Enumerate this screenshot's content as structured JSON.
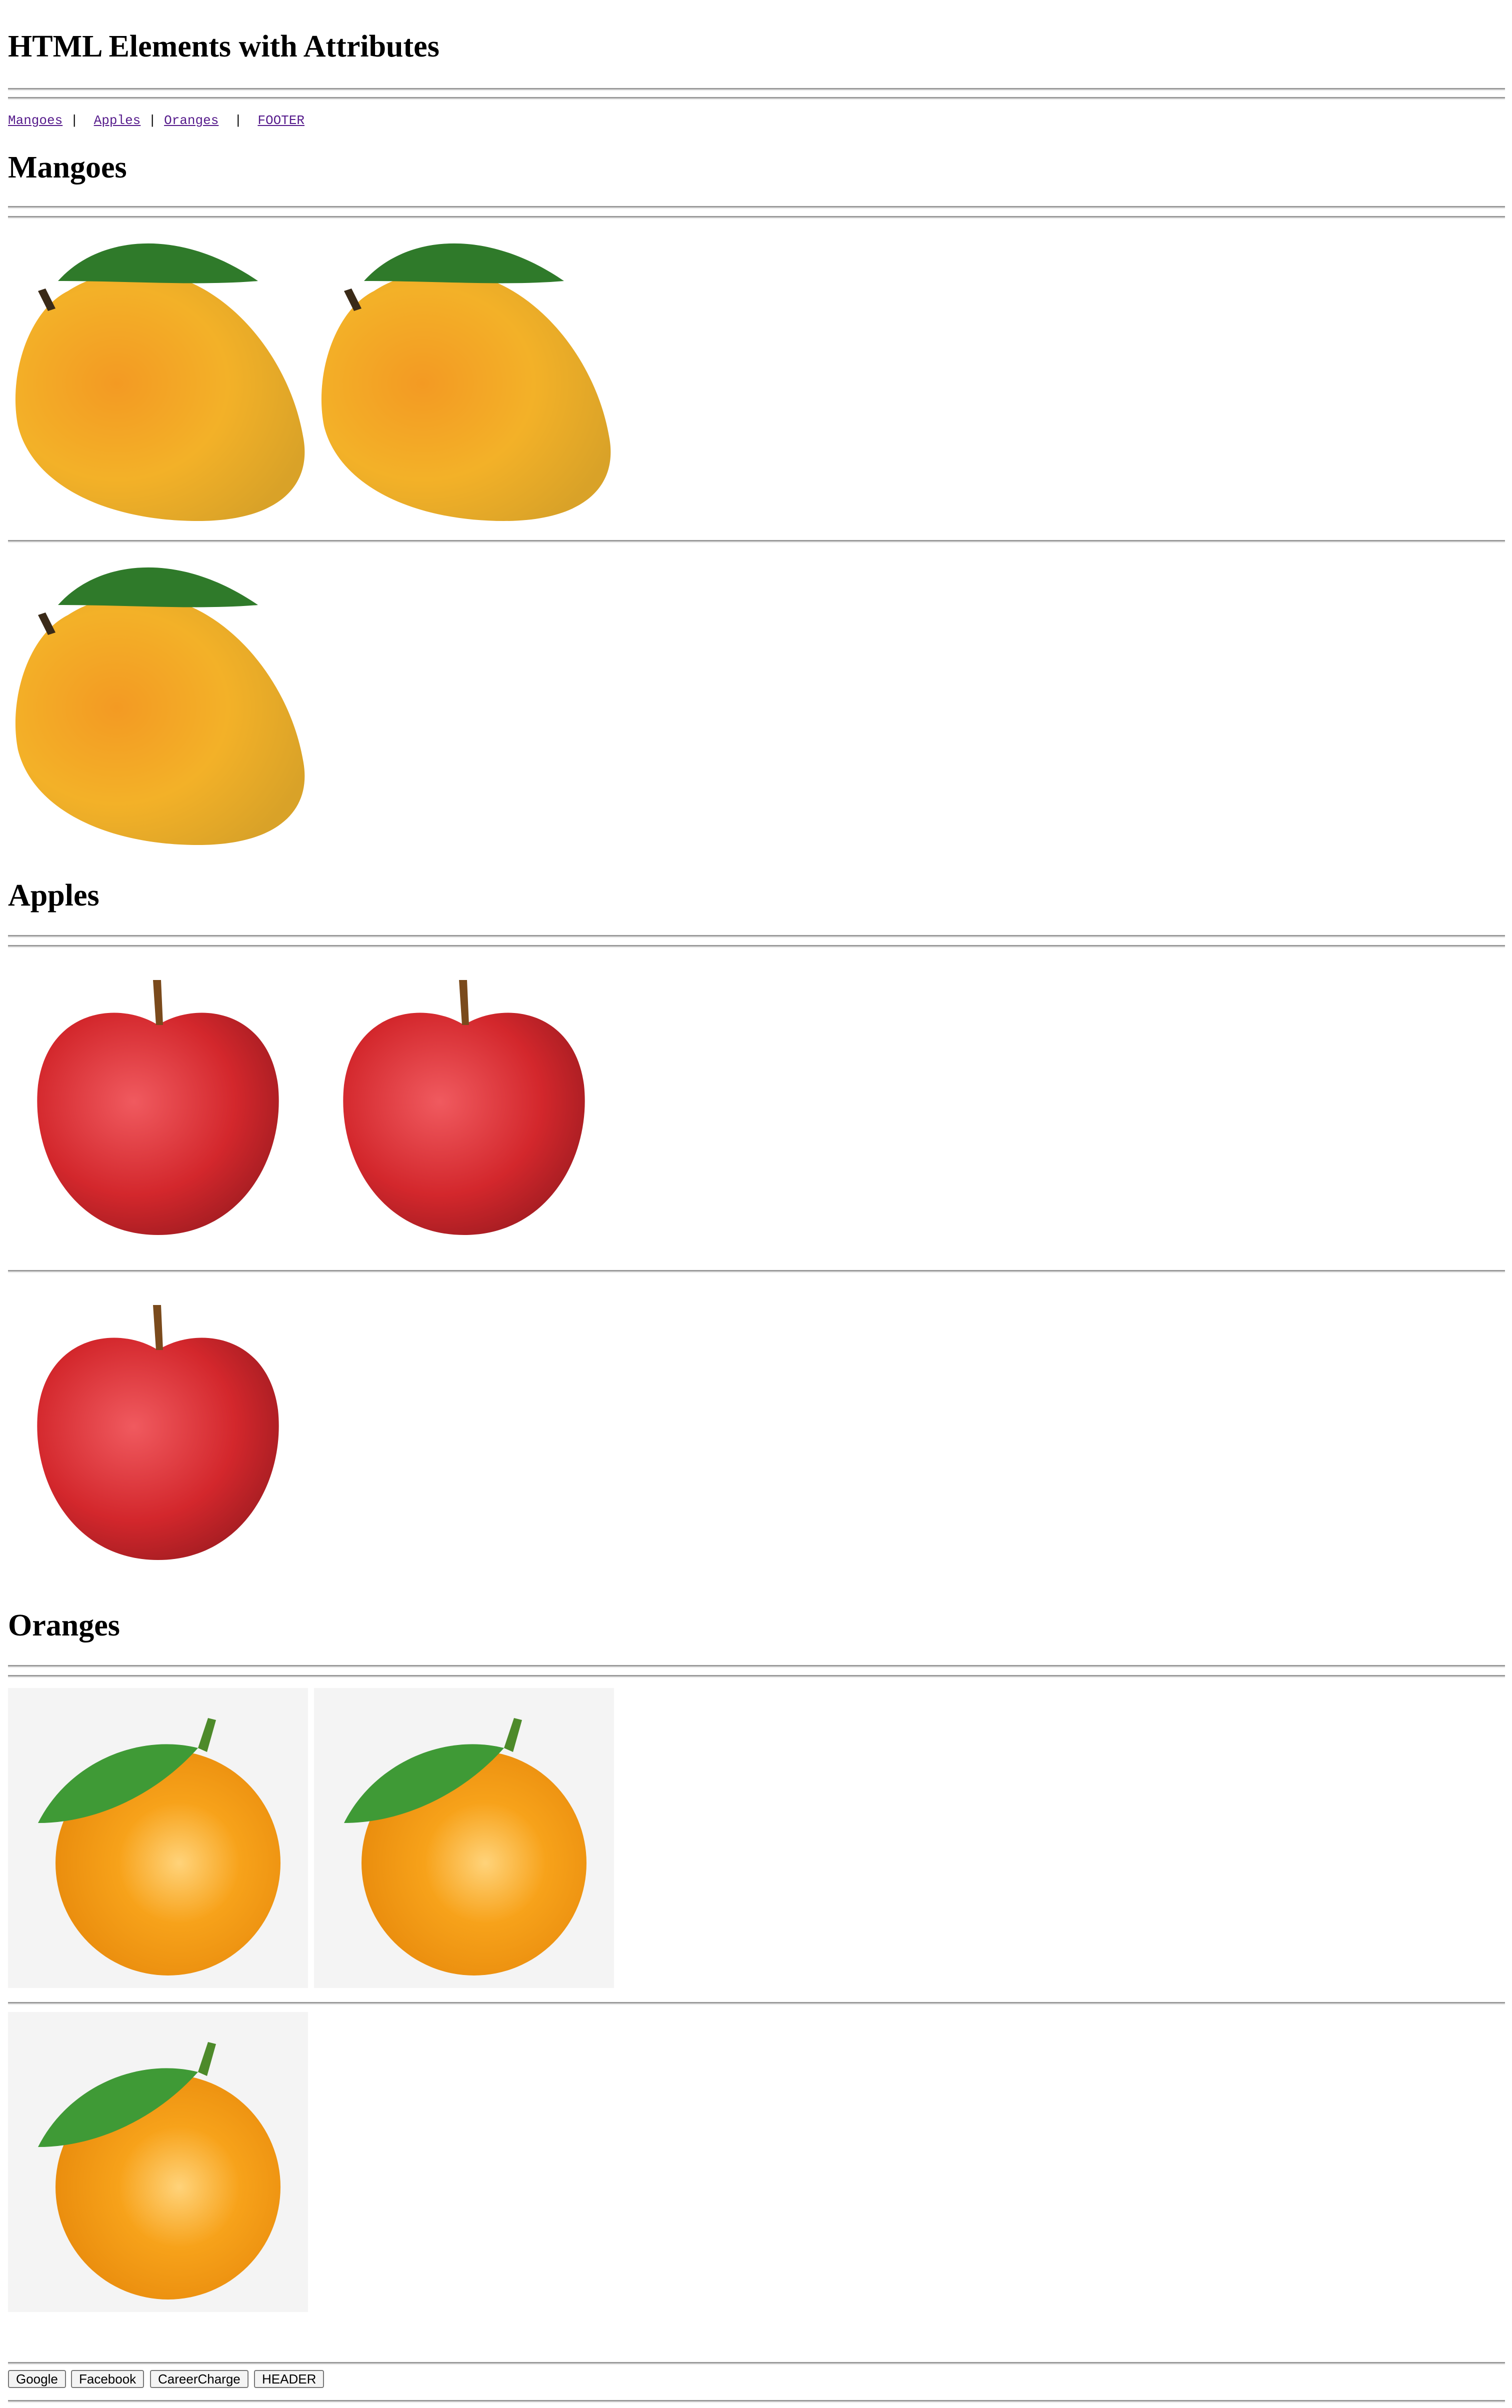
{
  "page": {
    "title": "HTML Elements with Attributes"
  },
  "nav": {
    "links": [
      "Mangoes",
      "Apples",
      "Oranges",
      "FOOTER"
    ],
    "separator": "|"
  },
  "sections": {
    "mangoes": {
      "heading": "Mangoes"
    },
    "apples": {
      "heading": "Apples"
    },
    "oranges": {
      "heading": "Oranges"
    }
  },
  "footer": {
    "buttons": [
      "Google",
      "Facebook",
      "CareerCharge",
      "HEADER"
    ]
  },
  "colors": {
    "link_visited": "#551a8b",
    "hr": "#9a9a9a",
    "mango": "#f3b128",
    "apple": "#d3272c",
    "orange": "#f7a21a",
    "leaf": "#2f7a2a"
  }
}
